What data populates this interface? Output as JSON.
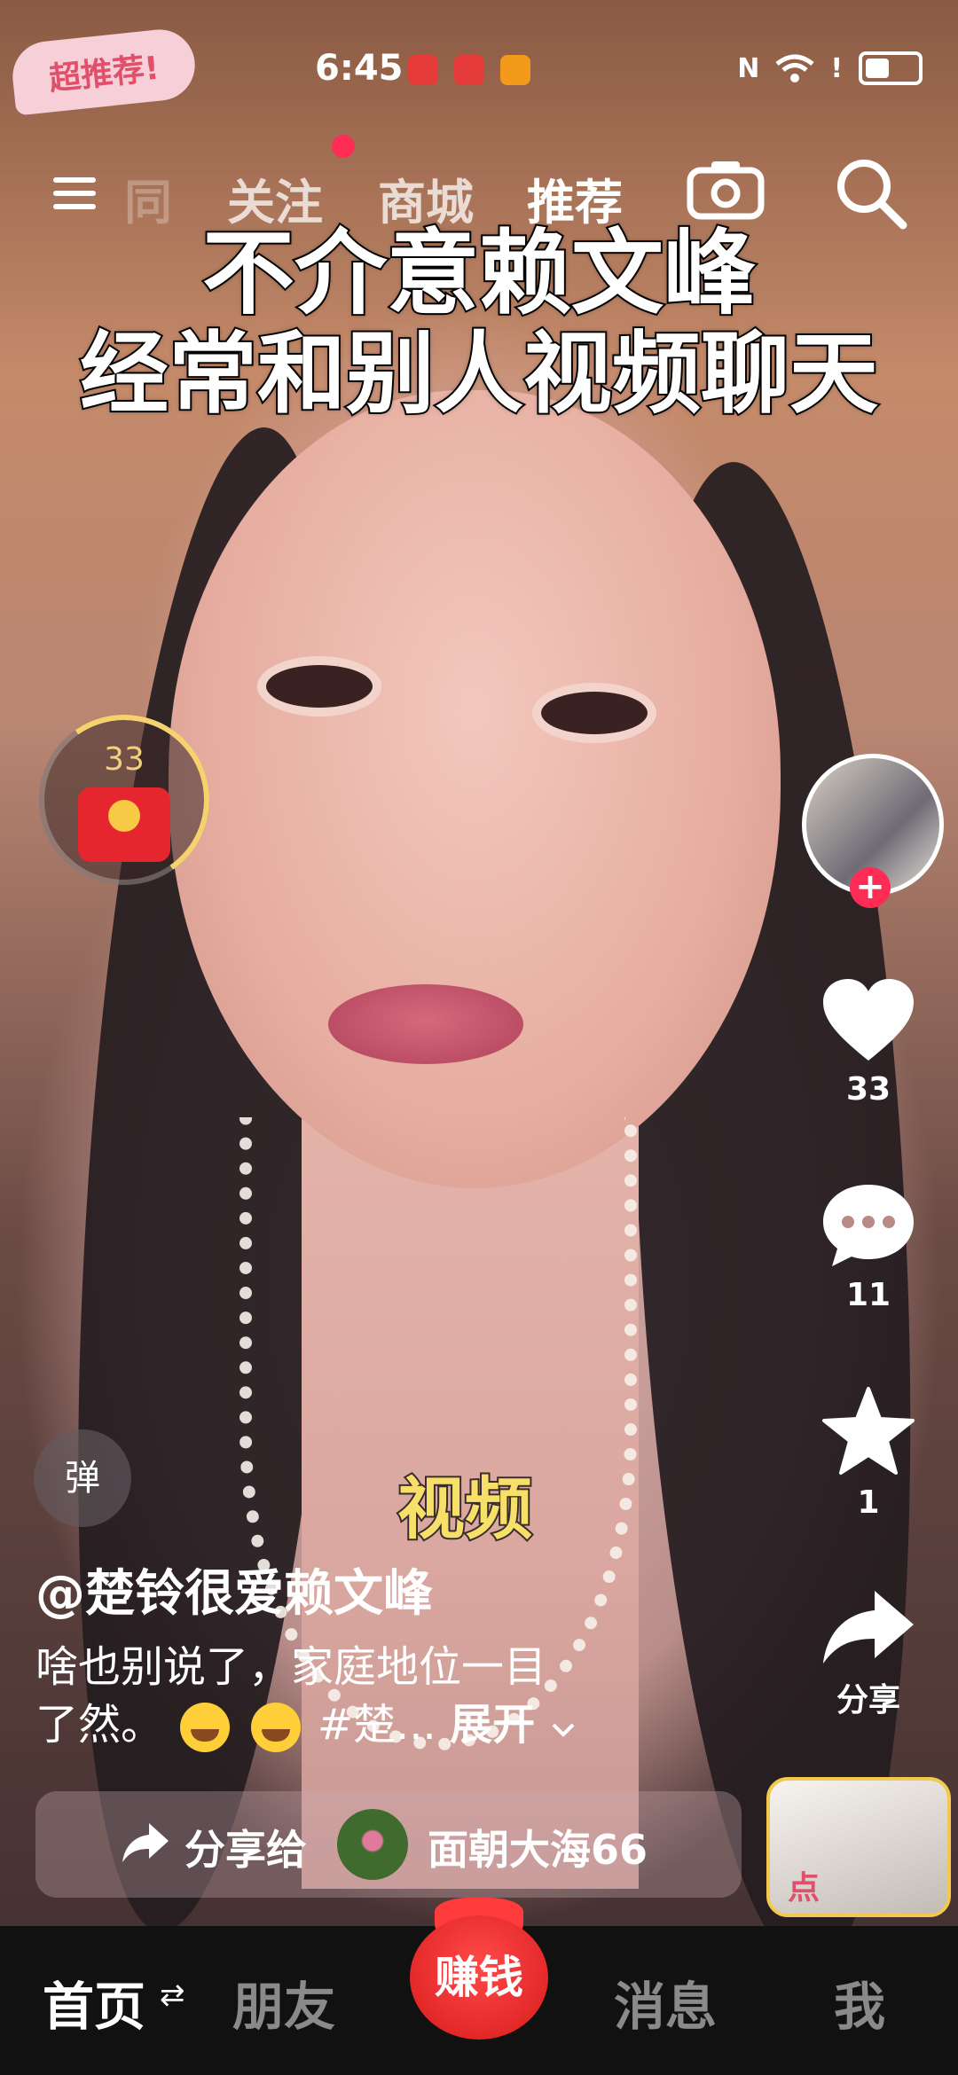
{
  "status_bar": {
    "time": "6:45",
    "icons": [
      "huawei-app-icon",
      "huawei-app-icon",
      "orange-app-icon",
      "nfc-icon",
      "wifi-icon",
      "alert-icon",
      "battery-icon"
    ],
    "nfc_label": "N",
    "alert_label": "!"
  },
  "promo_badge": {
    "label": "超推荐!"
  },
  "top_nav": {
    "tabs": [
      {
        "label": "关注",
        "active": false
      },
      {
        "label": "商城",
        "active": false
      },
      {
        "label": "推荐",
        "active": true
      }
    ],
    "hidden_prefix": "同"
  },
  "caption": {
    "line1": "不介意赖文峰",
    "line2": "经常和别人视频聊天"
  },
  "red_packet": {
    "count": "33"
  },
  "rail": {
    "like_count": "33",
    "comment_count": "11",
    "favorite_count": "1",
    "share_label": "分享",
    "follow_symbol": "+"
  },
  "danmu": {
    "label": "弹"
  },
  "video_tag": {
    "label": "视频"
  },
  "post": {
    "author": "@楚铃很爱赖文峰",
    "desc_line1": "啥也别说了，家庭地位一目",
    "desc_line2_start": "了然。",
    "desc_line2_tail": "#楚...",
    "expand_label": "展开",
    "expand_icon": "chevron-down-icon"
  },
  "share_row": {
    "label": "分享给",
    "friend_name": "面朝大海66"
  },
  "corner_promo": {
    "label": "点"
  },
  "bottom_nav": {
    "items": [
      {
        "label": "首页",
        "active": true
      },
      {
        "label": "朋友",
        "active": false
      },
      {
        "label": "消息",
        "active": false
      },
      {
        "label": "我",
        "active": false
      }
    ],
    "swap_icon": "⇄",
    "earn_label": "赚钱"
  },
  "colors": {
    "accent_red": "#fe2c55",
    "earn_red": "#e52222",
    "gold": "#f6d26f",
    "nav_bg": "#111111"
  }
}
